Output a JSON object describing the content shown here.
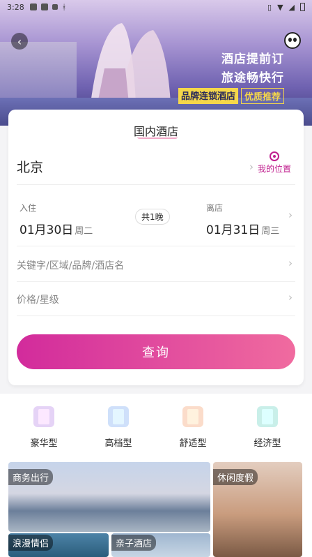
{
  "status": {
    "time": "3:28"
  },
  "banner": {
    "line1": "酒店提前订",
    "line2": "旅途畅快行",
    "tag1": "品牌连锁酒店",
    "tag2": "优质推荐"
  },
  "card": {
    "tab_title": "国内酒店",
    "city": "北京",
    "location_label": "我的位置",
    "checkin_label": "入住",
    "checkin_date": "01月30日",
    "checkin_weekday": "周二",
    "nights": "共1晚",
    "checkout_label": "离店",
    "checkout_date": "01月31日",
    "checkout_weekday": "周三",
    "keyword_placeholder": "关键字/区域/品牌/酒店名",
    "price_placeholder": "价格/星级",
    "search_label": "查询"
  },
  "categories": [
    {
      "label": "豪华型",
      "color": "#a670d8"
    },
    {
      "label": "高档型",
      "color": "#4f8de6"
    },
    {
      "label": "舒适型",
      "color": "#f28c5c"
    },
    {
      "label": "经济型",
      "color": "#2fb5a8"
    }
  ],
  "tiles": [
    {
      "label": "商务出行"
    },
    {
      "label": "休闲度假"
    },
    {
      "label": "浪漫情侣"
    },
    {
      "label": "亲子酒店"
    }
  ]
}
